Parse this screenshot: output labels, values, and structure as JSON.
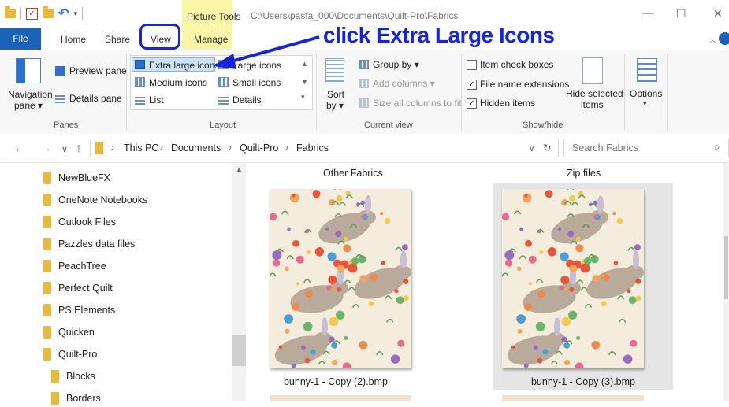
{
  "window": {
    "title_path": "C:\\Users\\pasfa_000\\Documents\\Quilt-Pro\\Fabrics",
    "contextual_group": "Picture Tools",
    "minimize": "—",
    "maximize": "☐",
    "close": "✕"
  },
  "tabs": {
    "file": "File",
    "home": "Home",
    "share": "Share",
    "view": "View",
    "manage": "Manage"
  },
  "annotation": {
    "text": "click Extra Large Icons",
    "color": "#1426d8"
  },
  "ribbon": {
    "panes": {
      "label": "Panes",
      "navigation_pane": "Navigation",
      "navigation_pane2": "pane ▾",
      "preview_pane": "Preview pane",
      "details_pane": "Details pane"
    },
    "layout": {
      "label": "Layout",
      "extra_large_icons": "Extra large icons",
      "large_icons": "Large icons",
      "medium_icons": "Medium icons",
      "small_icons": "Small icons",
      "list": "List",
      "details": "Details"
    },
    "current_view": {
      "label": "Current view",
      "sort_by": "Sort",
      "sort_by2": "by ▾",
      "group_by": "Group by ▾",
      "add_columns": "Add columns ▾",
      "size_all_columns": "Size all columns to fit"
    },
    "show_hide": {
      "label": "Show/hide",
      "item_check_boxes": "Item check boxes",
      "item_check_boxes_checked": false,
      "file_name_extensions": "File name extensions",
      "file_name_extensions_checked": true,
      "hidden_items": "Hidden items",
      "hidden_items_checked": true,
      "hide_selected_items": "Hide selected",
      "hide_selected_items2": "items"
    },
    "options": "Options"
  },
  "address": {
    "crumbs": [
      "This PC",
      "Documents",
      "Quilt-Pro",
      "Fabrics"
    ],
    "search_placeholder": "Search Fabrics"
  },
  "sidebar": {
    "items": [
      {
        "label": "NewBlueFX"
      },
      {
        "label": "OneNote Notebooks"
      },
      {
        "label": "Outlook Files"
      },
      {
        "label": "Pazzles data files"
      },
      {
        "label": "PeachTree"
      },
      {
        "label": "Perfect Quilt"
      },
      {
        "label": "PS Elements"
      },
      {
        "label": "Quicken"
      },
      {
        "label": "Quilt-Pro"
      },
      {
        "label": "Blocks"
      },
      {
        "label": "Borders"
      }
    ]
  },
  "content": {
    "groups": [
      {
        "header": "Other Fabrics",
        "file": "bunny-1 - Copy (2).bmp"
      },
      {
        "header": "Zip files",
        "file": "bunny-1 - Copy (3).bmp"
      }
    ]
  }
}
